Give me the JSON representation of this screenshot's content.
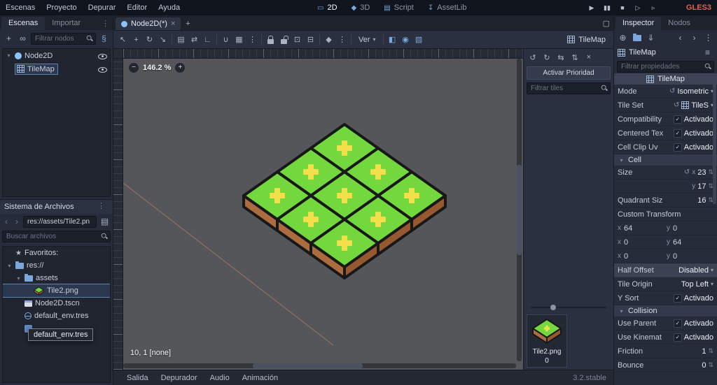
{
  "top_menu": {
    "items": [
      "Escenas",
      "Proyecto",
      "Depurar",
      "Editor",
      "Ayuda"
    ],
    "workspaces": [
      {
        "label": "2D",
        "glyph": "▭",
        "active": true
      },
      {
        "label": "3D",
        "glyph": "◆",
        "active": false
      },
      {
        "label": "Script",
        "glyph": "▤",
        "active": false
      },
      {
        "label": "AssetLib",
        "glyph": "↧",
        "active": false
      }
    ],
    "run_buttons": [
      {
        "name": "play-button",
        "glyph": "▶"
      },
      {
        "name": "pause-button",
        "glyph": "▮▮"
      },
      {
        "name": "stop-button",
        "glyph": "■"
      },
      {
        "name": "play-scene-button",
        "glyph": "▷"
      },
      {
        "name": "play-custom-scene-button",
        "glyph": "▹"
      }
    ],
    "renderer": "GLES3"
  },
  "scene_dock": {
    "tabs": [
      {
        "label": "Escenas",
        "active": true
      },
      {
        "label": "Importar",
        "active": false
      }
    ],
    "filter_placeholder": "Filtrar nodos",
    "nodes": [
      {
        "label": "Node2D"
      },
      {
        "label": "TileMap"
      }
    ]
  },
  "filesystem": {
    "title": "Sistema de Archivos",
    "breadcrumb": "res://assets/Tile2.pn",
    "search_placeholder": "Buscar archivos",
    "items": [
      {
        "icon": "star",
        "label": "Favoritos:",
        "indent": 0,
        "caret": false,
        "selected": false
      },
      {
        "icon": "folder",
        "label": "res://",
        "indent": 0,
        "caret": true,
        "selected": false
      },
      {
        "icon": "folder",
        "label": "assets",
        "indent": 1,
        "caret": true,
        "selected": false
      },
      {
        "icon": "tile",
        "label": "Tile2.png",
        "indent": 2,
        "caret": false,
        "selected": true
      },
      {
        "icon": "scene",
        "label": "Node2D.tscn",
        "indent": 1,
        "caret": false,
        "selected": false
      },
      {
        "icon": "globe",
        "label": "default_env.tres",
        "indent": 1,
        "caret": false,
        "selected": false
      },
      {
        "icon": "bluefile",
        "label": "",
        "indent": 1,
        "caret": false,
        "selected": false
      }
    ],
    "tooltip": "default_env.tres"
  },
  "scene_tabs": {
    "tab_label": "Node2D(*)"
  },
  "toolbar": {
    "items": [
      {
        "type": "icon",
        "name": "select-tool-icon",
        "glyph": "↖"
      },
      {
        "type": "icon",
        "name": "move-tool-icon",
        "glyph": "+"
      },
      {
        "type": "icon",
        "name": "rotate-tool-icon",
        "glyph": "↻"
      },
      {
        "type": "icon",
        "name": "scale-tool-icon",
        "glyph": "↘"
      },
      {
        "type": "div"
      },
      {
        "type": "icon",
        "name": "list-select-icon",
        "glyph": "▤"
      },
      {
        "type": "icon",
        "name": "pan-tool-icon",
        "glyph": "⇄"
      },
      {
        "type": "icon",
        "name": "ruler-icon",
        "glyph": "∟"
      },
      {
        "type": "div"
      },
      {
        "type": "icon",
        "name": "smart-snap-icon",
        "glyph": "∪"
      },
      {
        "type": "icon",
        "name": "grid-snap-icon",
        "glyph": "▦"
      },
      {
        "type": "icon",
        "name": "snap-options-icon",
        "glyph": "⋮"
      },
      {
        "type": "div"
      },
      {
        "type": "icon",
        "name": "lock-icon",
        "css": "i-lock"
      },
      {
        "type": "icon",
        "name": "unlock-icon",
        "css": "i-unlock"
      },
      {
        "type": "icon",
        "name": "group-icon",
        "glyph": "⊡"
      },
      {
        "type": "icon",
        "name": "ungroup-icon",
        "glyph": "⊟"
      },
      {
        "type": "div"
      },
      {
        "type": "icon",
        "name": "skeleton-icon",
        "glyph": "◆"
      },
      {
        "type": "icon",
        "name": "skeleton-options-icon",
        "glyph": "⋮"
      },
      {
        "type": "div"
      },
      {
        "type": "menu",
        "name": "view-menu",
        "label": "Ver"
      },
      {
        "type": "div"
      },
      {
        "type": "icon",
        "name": "bucket-fill-icon",
        "glyph": "◧",
        "blue": true
      },
      {
        "type": "icon",
        "name": "tile-picker-icon",
        "glyph": "◉",
        "blue": true
      },
      {
        "type": "icon",
        "name": "region-select-icon",
        "glyph": "▧",
        "blue": true
      }
    ],
    "context_label": "TileMap"
  },
  "canvas": {
    "zoom": "146.2 %",
    "status": "10, 1 [none]"
  },
  "tilemap": {
    "cols": 3,
    "rows": 3
  },
  "palette": {
    "transform_icons": [
      {
        "name": "rotate-left-icon",
        "glyph": "↺"
      },
      {
        "name": "rotate-right-icon",
        "glyph": "↻"
      },
      {
        "name": "flip-horizontal-icon",
        "glyph": "⇆"
      },
      {
        "name": "flip-vertical-icon",
        "glyph": "⇅"
      },
      {
        "name": "clear-transform-icon",
        "glyph": "×"
      }
    ],
    "priority_label": "Activar Prioridad",
    "filter_placeholder": "Filtrar tiles",
    "tile_name": "Tile2.png",
    "tile_id": "0"
  },
  "inspector": {
    "tabs": [
      {
        "label": "Inspector",
        "active": true
      },
      {
        "label": "Nodos",
        "active": false
      }
    ],
    "node_name": "TileMap",
    "filter_placeholder": "Filtrar propiedades",
    "section_tilemap": "TileMap",
    "section_cell": "Cell",
    "section_collision": "Collision",
    "rows": {
      "mode": {
        "label": "Mode",
        "value": "Isometric"
      },
      "tile_set": {
        "label": "Tile Set",
        "value": "TileS"
      },
      "compatibility": {
        "label": "Compatibility",
        "value": "Activado"
      },
      "centered_tex": {
        "label": "Centered Tex",
        "value": "Activado"
      },
      "cell_clip_uv": {
        "label": "Cell Clip Uv",
        "value": "Activado"
      },
      "size": {
        "label": "Size",
        "x_label": "x",
        "x": "23",
        "y_label": "y",
        "y": "17"
      },
      "quadrant": {
        "label": "Quadrant Siz",
        "value": "16"
      },
      "custom_transform": {
        "label": "Custom Transform",
        "r1": {
          "al": "x",
          "a": "64",
          "bl": "y",
          "b": "0"
        },
        "r2": {
          "al": "x",
          "a": "0",
          "bl": "y",
          "b": "64"
        },
        "r3": {
          "al": "x",
          "a": "0",
          "bl": "y",
          "b": "0"
        }
      },
      "half_offset": {
        "label": "Half Offset",
        "value": "Disabled"
      },
      "tile_origin": {
        "label": "Tile Origin",
        "value": "Top Left"
      },
      "y_sort": {
        "label": "Y Sort",
        "value": "Activado"
      },
      "use_parent": {
        "label": "Use Parent",
        "value": "Activado"
      },
      "use_kinematic": {
        "label": "Use Kinemat",
        "value": "Activado"
      },
      "friction": {
        "label": "Friction",
        "value": "1"
      },
      "bounce": {
        "label": "Bounce",
        "value": "0"
      }
    }
  },
  "bottom_bar": {
    "items": [
      "Salida",
      "Depurador",
      "Audio",
      "Animación"
    ],
    "version": "3.2.stable"
  },
  "icons": {
    "close": "×",
    "plus": "+",
    "link": "∞",
    "attach_script": "§",
    "dots": "⋮",
    "expand": "▢",
    "caret_down": "▾",
    "caret_right": "▸",
    "back": "‹",
    "forward": "›",
    "star": "★",
    "minus_zoom": "−",
    "plus_zoom": "+",
    "check": "✓",
    "stepper": "⇅",
    "dropdown": "▾",
    "revert": "↺",
    "new_resource": "⊕",
    "save": "⇓",
    "tools": "≡",
    "split": "▤"
  }
}
